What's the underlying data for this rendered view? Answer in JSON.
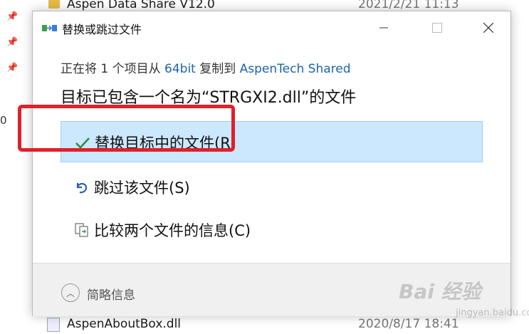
{
  "background": {
    "top_row": {
      "name": "Aspen Data Share V12.0",
      "date": "2021/2/21 11:13"
    },
    "bottom_row": {
      "name": "AspenAboutBox.dll",
      "date": "2020/8/17 18:41"
    },
    "edge_text": "0"
  },
  "dialog": {
    "title": "替换或跳过文件",
    "copy_line": {
      "prefix": "正在将 1 个项目从 ",
      "source": "64bit",
      "middle": " 复制到 ",
      "destination": "AspenTech Shared"
    },
    "headline": "目标已包含一个名为“STRGXI2.dll”的文件",
    "options": [
      {
        "label": "替换目标中的文件(R)",
        "icon": "checkmark-icon",
        "selected": true
      },
      {
        "label": "跳过该文件(S)",
        "icon": "undo-arrow-icon",
        "selected": false
      },
      {
        "label": "比较两个文件的信息(C)",
        "icon": "compare-files-icon",
        "selected": false
      }
    ],
    "fewer_details": "简略信息"
  },
  "watermark": {
    "text": "Bai 经验",
    "sub": "jingyan.baidu.com"
  },
  "colors": {
    "accent": "#1a64b0",
    "selection": "#cce8ff",
    "highlight": "#e0202a"
  }
}
